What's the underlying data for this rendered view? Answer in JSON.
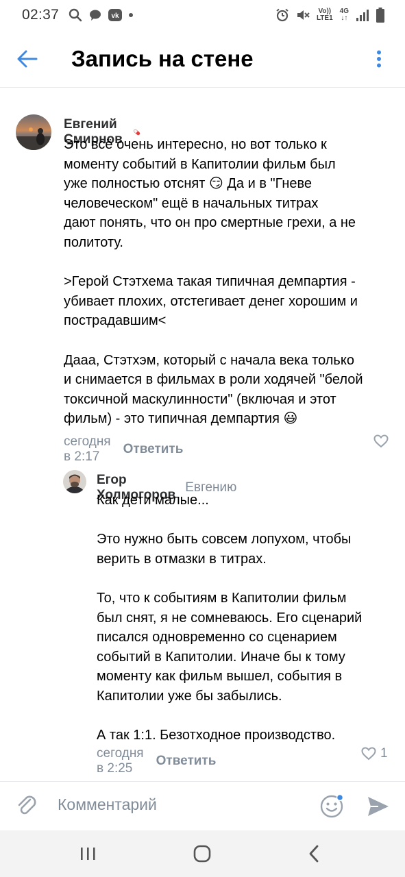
{
  "status_bar": {
    "time": "02:37",
    "volte": "Vo))",
    "lte": "LTE1",
    "network": "4G",
    "icons": [
      "search-icon",
      "chat-bubble-icon",
      "vk-icon",
      "dot-icon",
      "alarm-icon",
      "mute-icon",
      "signal-icon",
      "battery-icon"
    ]
  },
  "header": {
    "title": "Запись на стене"
  },
  "comments": [
    {
      "author": "Евгений Смирнов",
      "badge": "pill-emoji-icon",
      "text": "Это всё очень интересно, но вот только к\nмоменту событий в Капитолии фильм был\nуже полностью отснят 😏 Да и в \"Гневе\nчеловеческом\" ещё в начальных титрах\nдают понять, что он про смертные грехи, а не\nполитоту.\n\n>Герой Стэтхема такая типичная демпартия -\nубивает плохих, отстегивает денег хорошим и\nпострадавшим<\n\nДааа, Стэтхэм, который с начала века только\nи снимается в фильмах в роли ходячей \"белой\nтоксичной маскулинности\" (включая и этот\nфильм) - это типичная демпартия 😃",
      "time": "сегодня в 2:17",
      "reply_label": "Ответить",
      "likes": ""
    },
    {
      "author": "Егор Холмогоров",
      "reply_to": "Евгению",
      "text": "Как дети малые...\n\nЭто нужно быть совсем лопухом, чтобы\nверить в отмазки в титрах.\n\nТо, что к событиям в Капитолии фильм\nбыл снят, я не сомневаюсь. Его сценарий\nписался одновременно со сценарием\nсобытий в Капитолии. Иначе бы к тому\nмоменту как фильм вышел, события в\nКапитолии уже бы забылись.\n\nА так 1:1. Безотходное производство.",
      "time": "сегодня в 2:25",
      "reply_label": "Ответить",
      "likes": "1"
    }
  ],
  "input": {
    "placeholder": "Комментарий"
  },
  "colors": {
    "accent": "#3f8ae0",
    "secondary_text": "#818c99",
    "divider": "#e7e8ec"
  }
}
